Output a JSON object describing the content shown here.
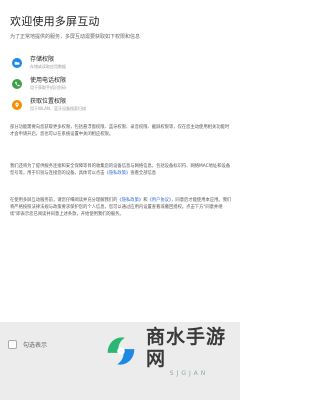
{
  "header": {
    "title": "欢迎使用多屏互动",
    "subtitle": "为了正常地提供的服务，多屏互动需要获取如下权限和信息"
  },
  "permissions": [
    {
      "name": "存储权限",
      "desc": "存储或读取应用数据",
      "icon": "folder-icon",
      "color": "#1e88e5"
    },
    {
      "name": "使用电话权限",
      "desc": "用于获取手机识别码",
      "icon": "phone-icon",
      "color": "#43a047"
    },
    {
      "name": "获取位置权限",
      "desc": "用于WLAN、蓝牙设备搜索扫描",
      "icon": "location-icon",
      "color": "#fb8c00"
    }
  ],
  "paragraphs": {
    "p1": "部分功能需要向您获取更多权限，包括悬浮窗权限、蓝牙权限、录音权限、截屏权限等，仅在您主动使用相关功能时才会申请开启，您也可以在系统设置中关闭相应权限。",
    "p2_prefix": "我们还将为了提供服务连接和安全保障等目的收集您的设备信息与网络信息，包括设备标识符、网络MAC地址和设备型号等，用于识别与连接您的设备。具体可以点击",
    "p2_link": "《隐私政策》",
    "p2_suffix": "查看全部信息",
    "p3_prefix": "在使用多屏互动服务前，请您仔细阅读并充分理解我们的",
    "p3_link1": "《隐私政策》",
    "p3_mid": "和",
    "p3_link2": "《用户协议》",
    "p3_suffix": "，同意后才能使用本应用。我们将严格按照法律法规与政策要求保护您的个人信息，您可以通过应用内设置查看或撤回授权。点击下方\"同意并继续\"即表示您已阅读并同意上述条款，开始使用我们的服务。"
  },
  "footer": {
    "checkbox_label": "勾选表示",
    "next_label": ""
  },
  "watermark": {
    "name": "商水手游网",
    "domain": "SJGJAN"
  },
  "colors": {
    "link": "#2f6bd6",
    "watermark_green": "#2bb673",
    "watermark_blue": "#1e88e5"
  }
}
